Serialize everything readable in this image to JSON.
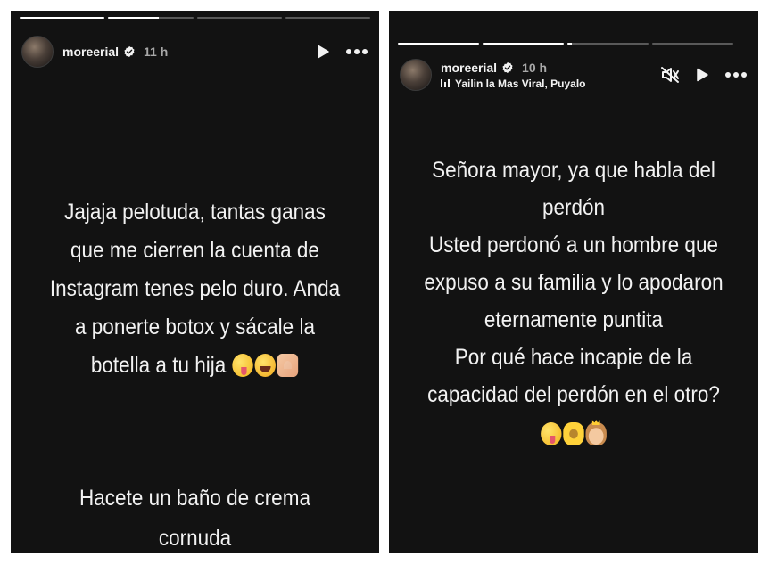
{
  "stories": [
    {
      "progress": [
        1,
        0.6,
        0,
        0
      ],
      "username": "moreerial",
      "time": "11 h",
      "main_lines": [
        "Jajaja pelotuda, tantas ganas",
        "que me cierren la cuenta de",
        "Instagram tenes pelo duro. Anda",
        "a ponerte botox y sácale la",
        "botella a tu hija"
      ],
      "main_emojis": [
        "zany-face-emoji",
        "tears-of-joy-emoji",
        "heart-hands-emoji"
      ],
      "bottom_lines": [
        "Hacete un baño de crema",
        "cornuda"
      ],
      "controls": [
        "play-icon",
        "more-icon"
      ]
    },
    {
      "progress": [
        1,
        1,
        0.05,
        0
      ],
      "username": "moreerial",
      "time": "10 h",
      "music": "Yailin la Mas Viral, Puyalo",
      "main_lines": [
        "Señora mayor, ya que habla del",
        "perdón",
        "Usted perdonó a un hombre que",
        "expuso a su familia y lo apodaron",
        "eternamente puntita",
        "Por qué hace incapie de la",
        "capacidad del perdón en el otro?"
      ],
      "main_emojis": [
        "winking-tongue-emoji",
        "sunflower-emoji",
        "princess-emoji"
      ],
      "controls": [
        "muted-icon",
        "play-icon",
        "more-icon"
      ]
    }
  ],
  "colors": {
    "story_bg": "#121212",
    "text": "#f2f2f2",
    "time": "#a8a8a8",
    "verified": "#f2f2f2"
  }
}
